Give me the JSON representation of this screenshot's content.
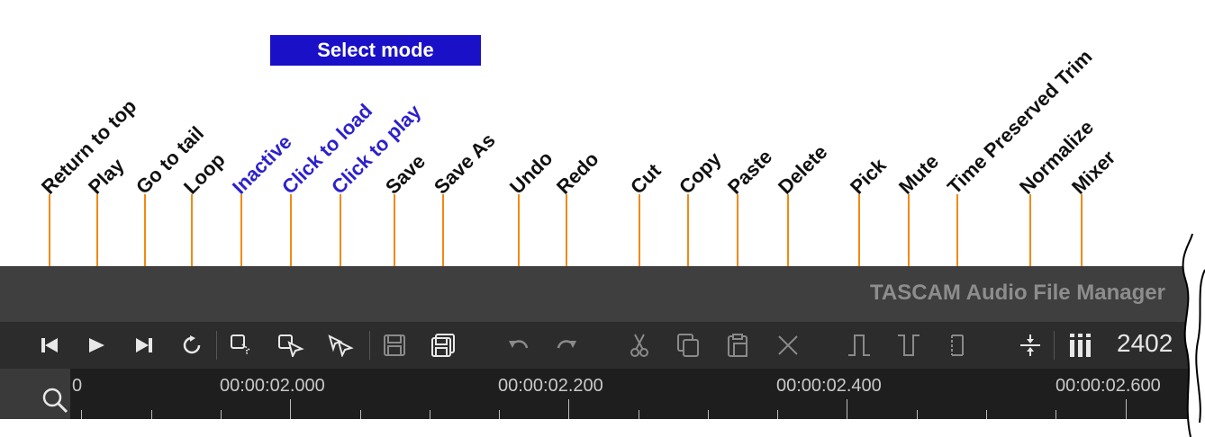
{
  "select_mode_label": "Select mode",
  "callouts": [
    {
      "label": "Return to top",
      "color": "#111111"
    },
    {
      "label": "Play",
      "color": "#111111"
    },
    {
      "label": "Go to tail",
      "color": "#111111"
    },
    {
      "label": "Loop",
      "color": "#111111"
    },
    {
      "label": "Inactive",
      "color": "#2d21cc"
    },
    {
      "label": "Click to load",
      "color": "#2d21cc"
    },
    {
      "label": "Click to play",
      "color": "#2d21cc"
    },
    {
      "label": "Save",
      "color": "#111111"
    },
    {
      "label": "Save As",
      "color": "#111111"
    },
    {
      "label": "Undo",
      "color": "#111111"
    },
    {
      "label": "Redo",
      "color": "#111111"
    },
    {
      "label": "Cut",
      "color": "#111111"
    },
    {
      "label": "Copy",
      "color": "#111111"
    },
    {
      "label": "Paste",
      "color": "#111111"
    },
    {
      "label": "Delete",
      "color": "#111111"
    },
    {
      "label": "Pick",
      "color": "#111111"
    },
    {
      "label": "Mute",
      "color": "#111111"
    },
    {
      "label": "Time Preserved Trim",
      "color": "#111111"
    },
    {
      "label": "Normalize",
      "color": "#111111"
    },
    {
      "label": "Mixer",
      "color": "#111111"
    }
  ],
  "app": {
    "title": "TASCAM Audio File Manager",
    "counter": "2402"
  },
  "toolbar": {
    "icons": [
      "return-to-top-icon",
      "play-icon",
      "go-to-tail-icon",
      "loop-icon",
      "select-inactive-icon",
      "select-click-to-load-icon",
      "select-click-to-play-icon",
      "save-icon",
      "save-as-icon",
      "undo-icon",
      "redo-icon",
      "cut-icon",
      "copy-icon",
      "paste-icon",
      "delete-icon",
      "pick-icon",
      "mute-icon",
      "time-preserved-trim-icon",
      "normalize-icon",
      "mixer-icon"
    ]
  },
  "ruler": {
    "left_fragment": "0",
    "labels": [
      "00:00:02.000",
      "00:00:02.200",
      "00:00:02.400",
      "00:00:02.600"
    ]
  },
  "colors": {
    "leader": "#f08a12",
    "select_mode_bg": "#1a10c8",
    "titlebar": "#3f3f3f",
    "toolbar": "#2c2c2c",
    "ruler": "#1e1e1e"
  }
}
